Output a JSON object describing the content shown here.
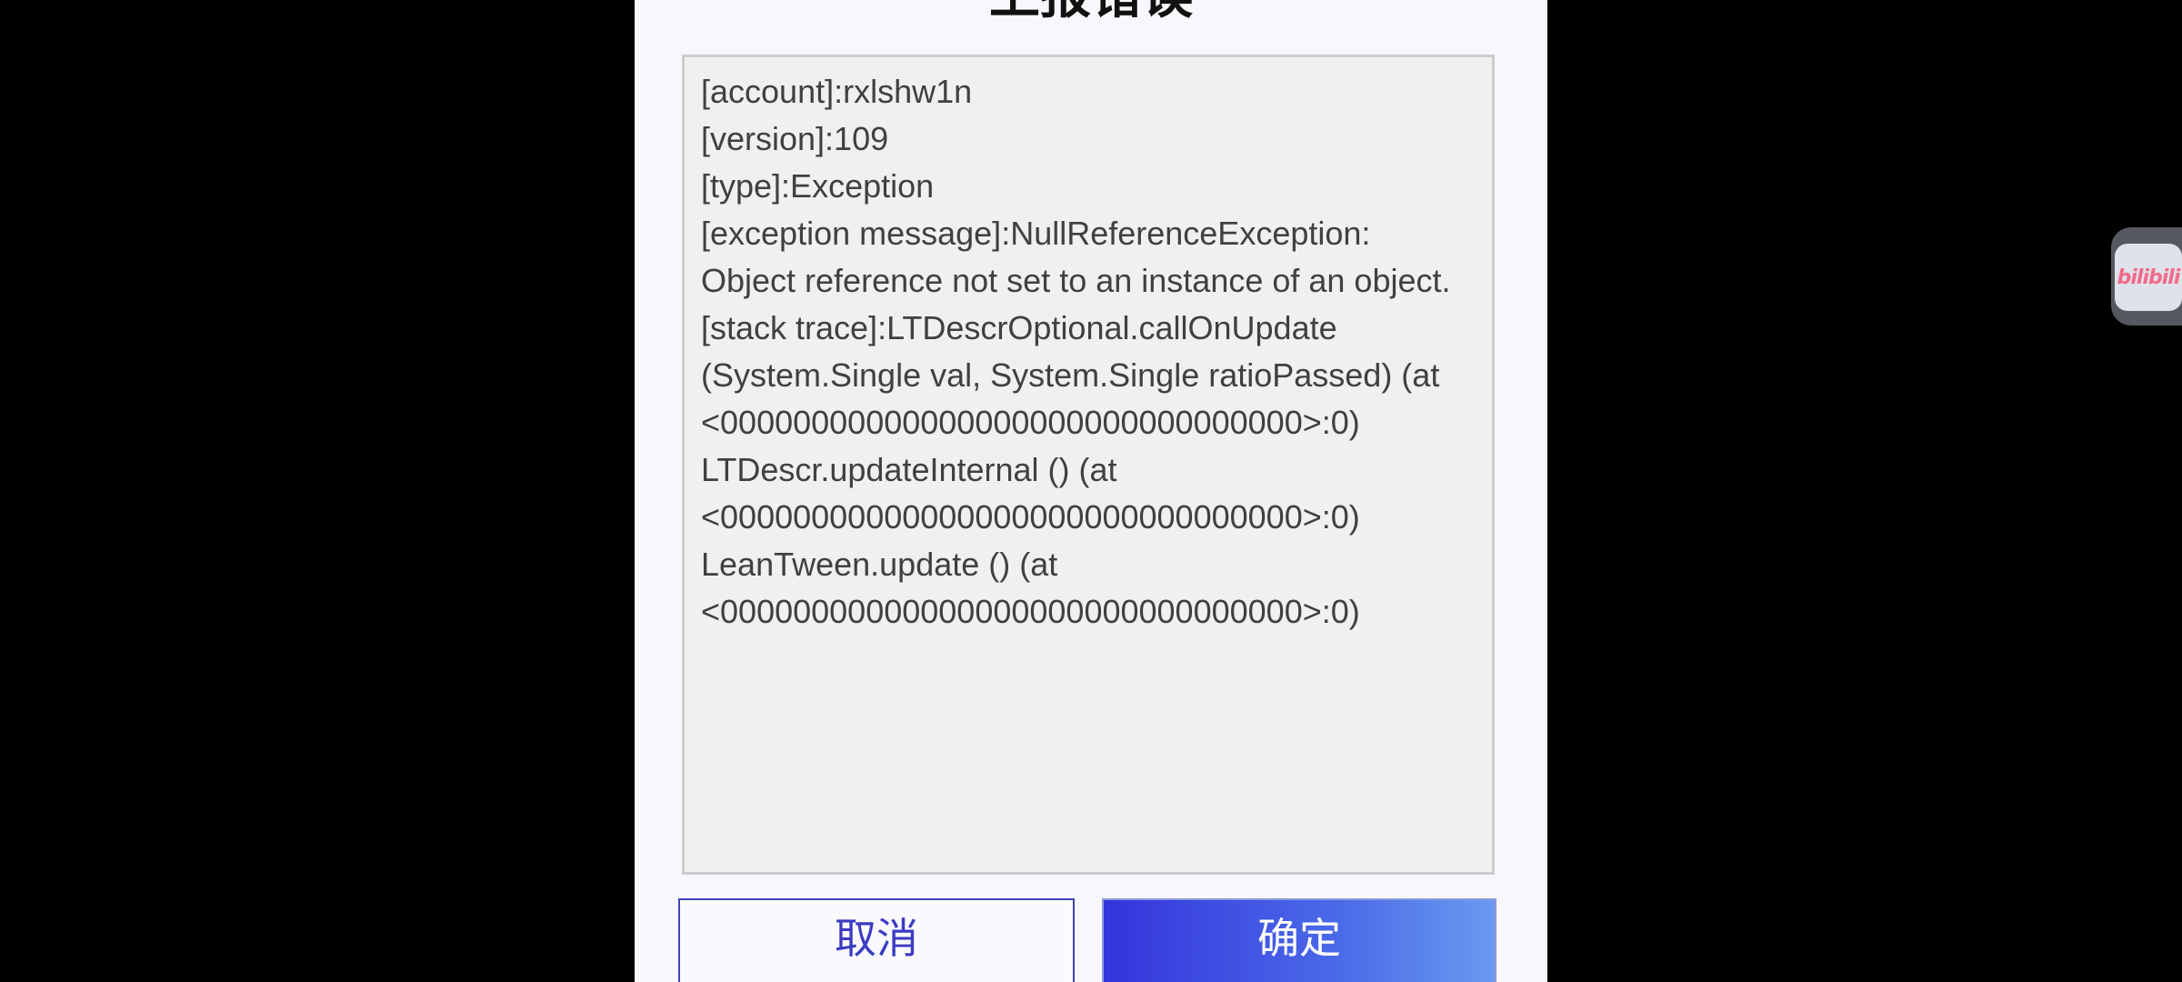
{
  "dialog": {
    "title": "上报错误",
    "log_lines": [
      "[account]:rxlshw1n",
      "[version]:109",
      "[type]:Exception",
      "[exception message]:NullReferenceException:",
      "Object reference not set to an instance of an object.",
      "[stack trace]:LTDescrOptional.callOnUpdate",
      "(System.Single val, System.Single ratioPassed) (at",
      "<00000000000000000000000000000000>:0)",
      "LTDescr.updateInternal () (at",
      "<00000000000000000000000000000000>:0)",
      "LeanTween.update () (at",
      "<00000000000000000000000000000000>:0)"
    ],
    "cancel_label": "取消",
    "confirm_label": "确定"
  },
  "float_badge": {
    "text": "bilibili",
    "icon": "bilibili-logo-icon",
    "color": "#f26b8a"
  },
  "colors": {
    "background": "#000000",
    "dialog_bg": "#f8f8fc",
    "accent": "#3434dc"
  }
}
